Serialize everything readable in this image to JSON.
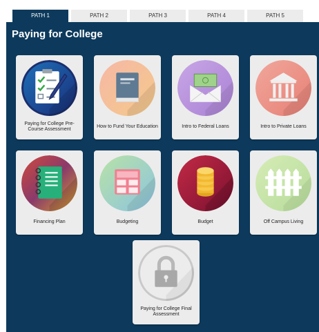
{
  "tabs": [
    {
      "label": "PATH 1",
      "active": true
    },
    {
      "label": "PATH 2",
      "active": false
    },
    {
      "label": "PATH 3",
      "active": false
    },
    {
      "label": "PATH 4",
      "active": false
    },
    {
      "label": "PATH 5",
      "active": false
    }
  ],
  "panel": {
    "title": "Paying for College",
    "background": "#0d3a5c"
  },
  "cards": [
    {
      "label": "Paying for College Pre-Course Assessment",
      "icon": "clipboard-checklist-icon"
    },
    {
      "label": "How to Fund Your Education",
      "icon": "book-icon"
    },
    {
      "label": "Intro to Federal Loans",
      "icon": "money-envelope-icon"
    },
    {
      "label": "Intro to Private Loans",
      "icon": "bank-building-icon"
    },
    {
      "label": "Financing Plan",
      "icon": "notebook-icon"
    },
    {
      "label": "Budgeting",
      "icon": "calculator-icon"
    },
    {
      "label": "Budget",
      "icon": "coin-stack-icon"
    },
    {
      "label": "Off Campus Living",
      "icon": "picket-fence-icon"
    },
    {
      "label": "Paying for College Final Assessment",
      "icon": "padlock-icon"
    }
  ]
}
